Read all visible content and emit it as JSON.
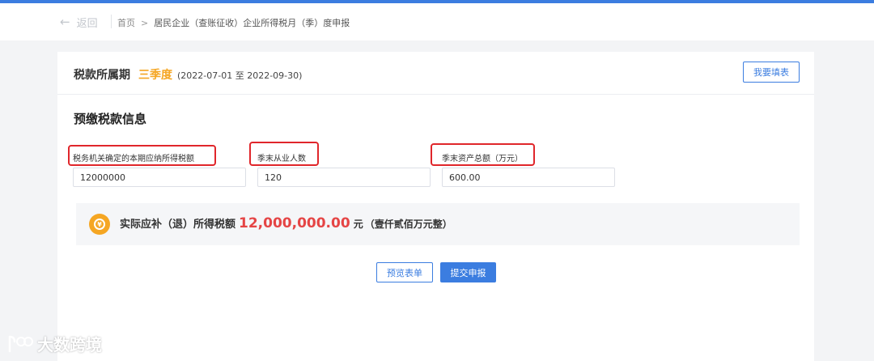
{
  "header": {
    "back_label": "返回",
    "breadcrumb": {
      "home": "首页",
      "separator": ">",
      "current": "居民企业（查账征收）企业所得税月（季）度申报"
    }
  },
  "period": {
    "label": "税款所属期",
    "quarter": "三季度",
    "range": "(2022-07-01 至 2022-09-30)",
    "fill_button": "我要填表"
  },
  "section": {
    "title": "预缴税款信息",
    "fields": [
      {
        "label": "税务机关确定的本期应纳所得税额",
        "value": "12000000"
      },
      {
        "label": "季末从业人数",
        "value": "120"
      },
      {
        "label": "季末资产总额（万元）",
        "value": "600.00"
      }
    ]
  },
  "result": {
    "coin_icon": "¥",
    "label": "实际应补（退）所得税额",
    "amount": "12,000,000.00",
    "unit": "元",
    "uppercase": "（壹仟贰佰万元整）"
  },
  "actions": {
    "preview": "预览表单",
    "submit": "提交申报"
  },
  "watermark": {
    "text": "大数跨境"
  },
  "colors": {
    "accent": "#3b7de0",
    "quarter": "#f5a623",
    "amount": "#e54545",
    "annotation": "#e0262b"
  }
}
